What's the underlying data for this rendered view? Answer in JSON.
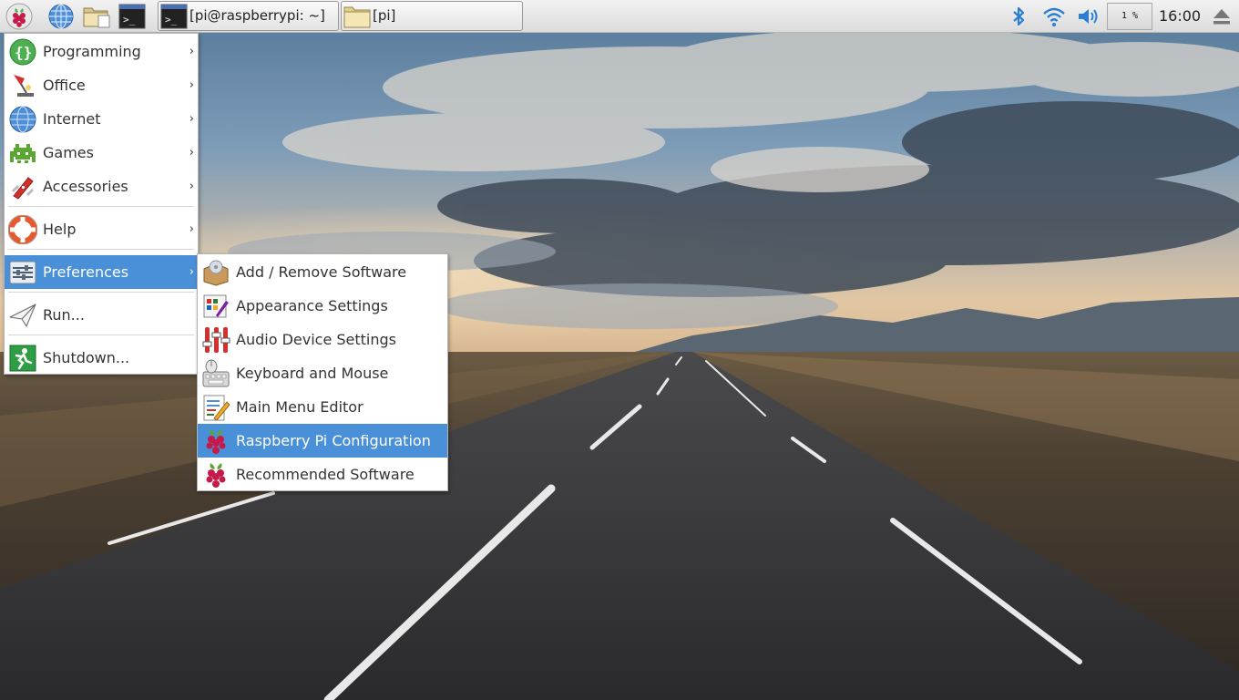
{
  "taskbar": {
    "launchers": [
      {
        "name": "raspberry-menu-icon"
      },
      {
        "name": "web-browser-icon"
      },
      {
        "name": "file-manager-icon"
      },
      {
        "name": "terminal-icon"
      }
    ],
    "tasks": [
      {
        "label": "[pi@raspberrypi: ~]",
        "icon": "terminal-icon"
      },
      {
        "label": "[pi]",
        "icon": "folder-icon"
      }
    ],
    "tray": {
      "bluetooth": "bluetooth-icon",
      "wifi": "wifi-icon",
      "volume": "volume-icon",
      "cpu_usage": "1 %",
      "clock": "16:00",
      "eject": "eject-icon"
    }
  },
  "main_menu": {
    "items": [
      {
        "label": "Programming",
        "icon": "programming-icon",
        "submenu": true
      },
      {
        "label": "Office",
        "icon": "office-icon",
        "submenu": true
      },
      {
        "label": "Internet",
        "icon": "internet-icon",
        "submenu": true
      },
      {
        "label": "Games",
        "icon": "games-icon",
        "submenu": true
      },
      {
        "label": "Accessories",
        "icon": "accessories-icon",
        "submenu": true
      },
      {
        "label": "Help",
        "icon": "help-icon",
        "submenu": true
      },
      {
        "label": "Preferences",
        "icon": "preferences-icon",
        "submenu": true,
        "highlighted": true
      },
      {
        "label": "Run...",
        "icon": "run-icon",
        "submenu": false
      },
      {
        "label": "Shutdown...",
        "icon": "shutdown-icon",
        "submenu": false
      }
    ],
    "arrow": "›"
  },
  "preferences_menu": {
    "items": [
      {
        "label": "Add / Remove Software",
        "icon": "software-package-icon"
      },
      {
        "label": "Appearance Settings",
        "icon": "appearance-icon"
      },
      {
        "label": "Audio Device Settings",
        "icon": "audio-mixer-icon"
      },
      {
        "label": "Keyboard and Mouse",
        "icon": "keyboard-mouse-icon"
      },
      {
        "label": "Main Menu Editor",
        "icon": "menu-editor-icon"
      },
      {
        "label": "Raspberry Pi Configuration",
        "icon": "raspberry-icon",
        "highlighted": true
      },
      {
        "label": "Recommended Software",
        "icon": "raspberry-icon"
      }
    ]
  },
  "colors": {
    "highlight": "#4a90d9",
    "taskbar": "#e6e6e6"
  }
}
